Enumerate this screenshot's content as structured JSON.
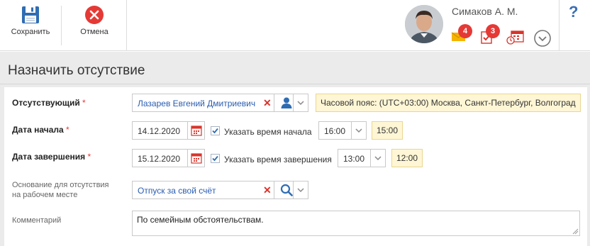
{
  "toolbar": {
    "save_label": "Сохранить",
    "cancel_label": "Отмена"
  },
  "user": {
    "name": "Симаков А. М.",
    "messages_count": "4",
    "tasks_count": "3"
  },
  "help_label": "?",
  "page": {
    "title": "Назначить отсутствие"
  },
  "form": {
    "absentee": {
      "label": "Отсутствующий",
      "required_mark": "*",
      "value": "Лазарев Евгений Дмитриевич",
      "timezone_note": "Часовой пояс: (UTC+03:00) Москва, Санкт-Петербург, Волгоград"
    },
    "start": {
      "label": "Дата начала",
      "required_mark": "*",
      "date": "14.12.2020",
      "checkbox_label": "Указать время начала",
      "time": "16:00",
      "time_note": "15:00"
    },
    "end": {
      "label": "Дата завершения",
      "required_mark": "*",
      "date": "15.12.2020",
      "checkbox_label": "Указать время завершения",
      "time": "13:00",
      "time_note": "12:00"
    },
    "reason": {
      "label_line1": "Основание для отсутствия",
      "label_line2": "на рабочем месте",
      "value": "Отпуск за свой счёт"
    },
    "comment": {
      "label": "Комментарий",
      "value": "По семейным обстоятельствам."
    }
  },
  "colors": {
    "accent": "#2a5db0",
    "danger": "#e53935",
    "note_bg": "#fff6d5"
  }
}
